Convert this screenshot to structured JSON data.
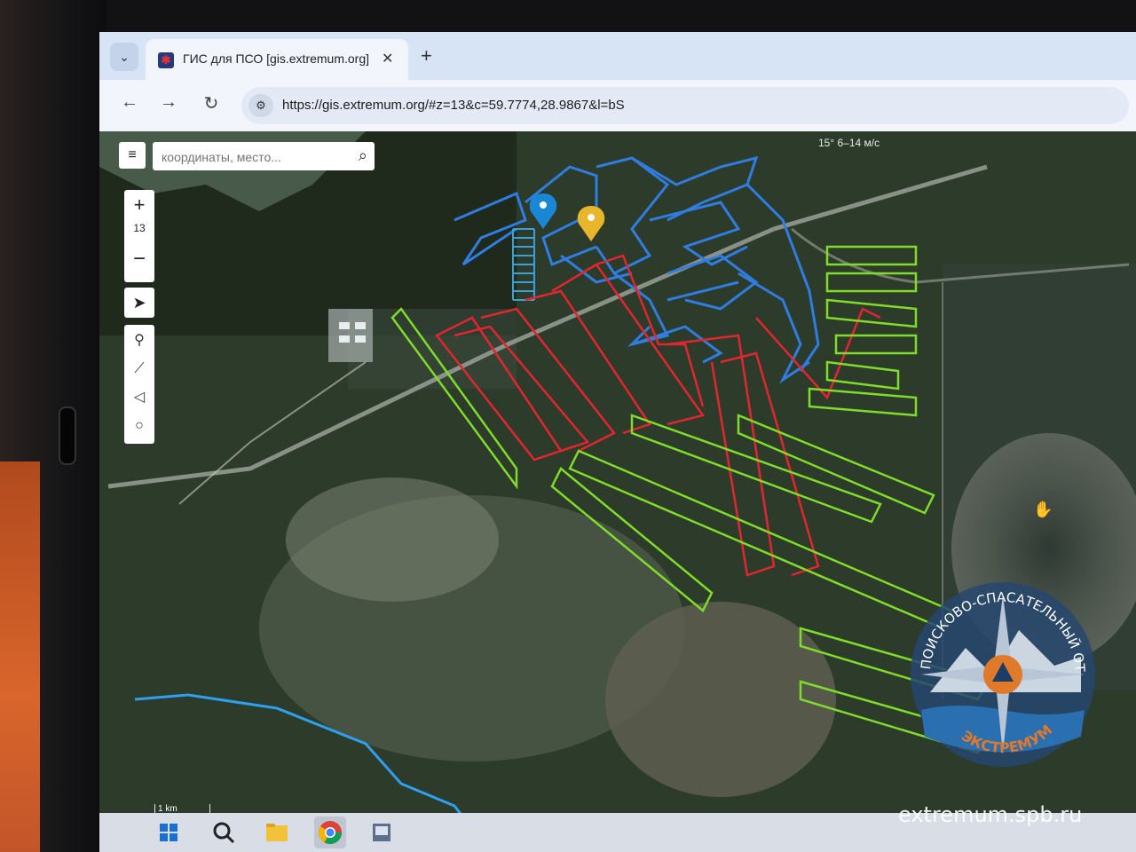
{
  "browser": {
    "tab_title": "ГИС для ПСО [gis.extremum.org]",
    "tab_close": "✕",
    "new_tab": "+",
    "url": "https://gis.extremum.org/#z=13&c=59.7774,28.9867&l=bS"
  },
  "map": {
    "search_placeholder": "координаты, место...",
    "zoom_in": "+",
    "zoom_out": "−",
    "zoom_level": "13",
    "weather": "15°   6–14 м/с",
    "scale_label": "1 km",
    "colors": {
      "searched_area": "#2f7de0",
      "assigned_area": "#e0262f",
      "planned_area": "#7fdc2a",
      "river": "#2f9ff0",
      "marker_blue": "#1a86d6",
      "marker_yellow": "#e8b62b"
    },
    "markers": [
      {
        "name": "blue",
        "icon": "map-marker-icon"
      },
      {
        "name": "yellow",
        "icon": "map-marker-icon"
      }
    ]
  },
  "taskbar": {
    "icons": [
      "windows-start-icon",
      "search-icon",
      "file-explorer-icon",
      "chrome-icon",
      "app-icon"
    ]
  },
  "watermark": {
    "site": "extremum.spb.ru",
    "logo_text_top": "ПОИСКОВО-СПАСАТЕЛЬНЫЙ ОТРЯД",
    "logo_text_bottom": "ЭКСТРЕМУМ"
  }
}
